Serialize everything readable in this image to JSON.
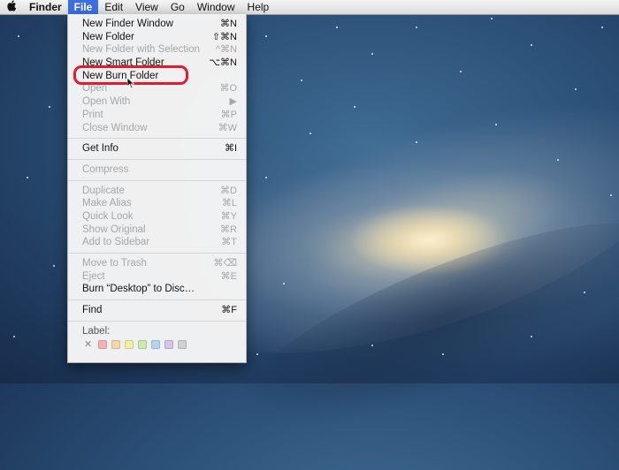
{
  "menubar": {
    "apple_icon": "apple-logo-icon",
    "app_name": "Finder",
    "items": [
      "File",
      "Edit",
      "View",
      "Go",
      "Window",
      "Help"
    ],
    "active": "File"
  },
  "file_menu": {
    "groups": [
      [
        {
          "label": "New Finder Window",
          "shortcut": "⌘N",
          "enabled": true
        },
        {
          "label": "New Folder",
          "shortcut": "⇧⌘N",
          "enabled": true
        },
        {
          "label": "New Folder with Selection",
          "shortcut": "^⌘N",
          "enabled": false
        },
        {
          "label": "New Smart Folder",
          "shortcut": "⌥⌘N",
          "enabled": true
        },
        {
          "label": "New Burn Folder",
          "shortcut": "",
          "enabled": true
        },
        {
          "label": "Open",
          "shortcut": "⌘O",
          "enabled": false
        },
        {
          "label": "Open With",
          "shortcut": "▶",
          "enabled": false
        },
        {
          "label": "Print",
          "shortcut": "⌘P",
          "enabled": false
        },
        {
          "label": "Close Window",
          "shortcut": "⌘W",
          "enabled": false
        }
      ],
      [
        {
          "label": "Get Info",
          "shortcut": "⌘I",
          "enabled": true
        }
      ],
      [
        {
          "label": "Compress",
          "shortcut": "",
          "enabled": false
        }
      ],
      [
        {
          "label": "Duplicate",
          "shortcut": "⌘D",
          "enabled": false
        },
        {
          "label": "Make Alias",
          "shortcut": "⌘L",
          "enabled": false
        },
        {
          "label": "Quick Look",
          "shortcut": "⌘Y",
          "enabled": false
        },
        {
          "label": "Show Original",
          "shortcut": "⌘R",
          "enabled": false
        },
        {
          "label": "Add to Sidebar",
          "shortcut": "⌘T",
          "enabled": false
        }
      ],
      [
        {
          "label": "Move to Trash",
          "shortcut": "⌘⌫",
          "enabled": false
        },
        {
          "label": "Eject",
          "shortcut": "⌘E",
          "enabled": false
        },
        {
          "label": "Burn “Desktop” to Disc…",
          "shortcut": "",
          "enabled": true
        }
      ],
      [
        {
          "label": "Find",
          "shortcut": "⌘F",
          "enabled": true
        }
      ]
    ],
    "label_heading": "Label:",
    "label_clear_icon": "x-icon",
    "label_colors": [
      "#f2b3b3",
      "#f5d6a8",
      "#f2efa2",
      "#c8ecb0",
      "#b6d3f2",
      "#d6c4ee",
      "#d2d2d2"
    ]
  },
  "annotation": {
    "highlight_color": "#e21b2d"
  }
}
